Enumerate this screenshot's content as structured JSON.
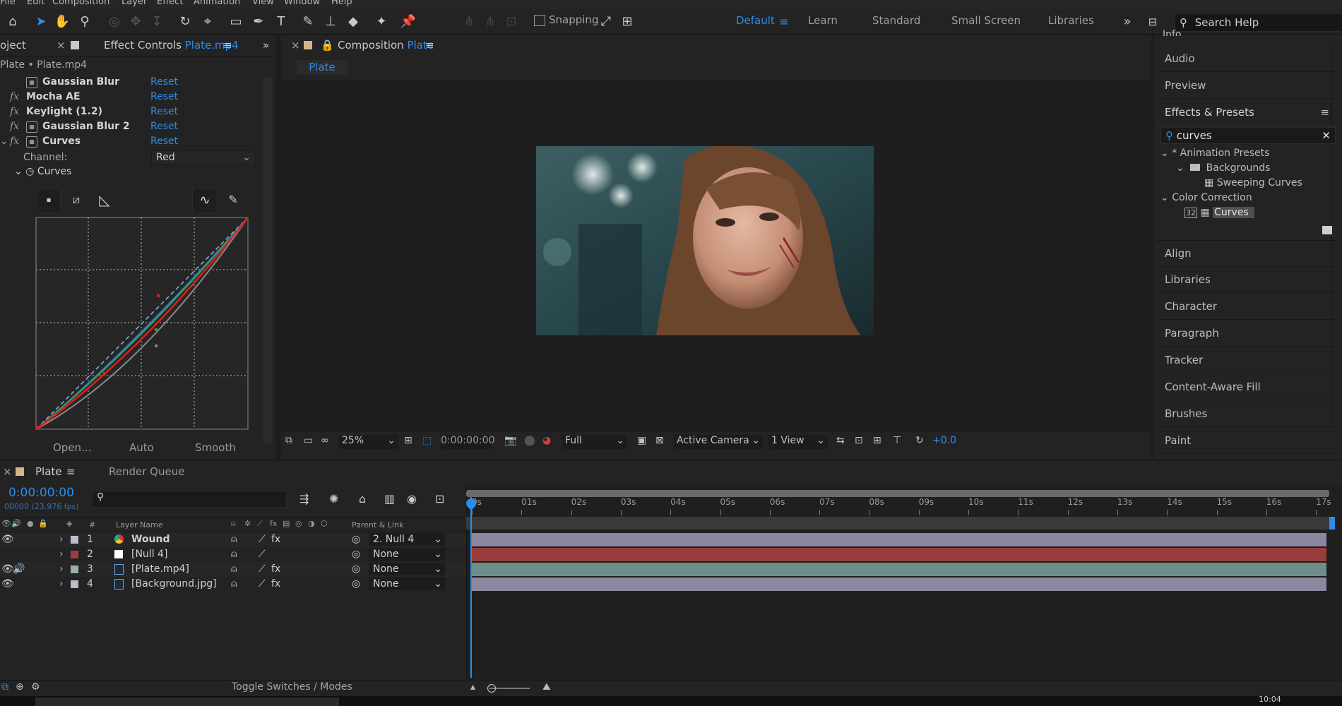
{
  "menu": [
    "File",
    "Edit",
    "Composition",
    "Layer",
    "Effect",
    "Animation",
    "View",
    "Window",
    "Help"
  ],
  "toolbar": {
    "snapping_label": "Snapping",
    "workspaces": [
      "Default",
      "Learn",
      "Standard",
      "Small Screen",
      "Libraries"
    ],
    "search_help_label": "Search Help"
  },
  "effect_controls": {
    "project_tab": "oject",
    "tab_label": "Effect Controls",
    "tab_target": "Plate.mp4",
    "breadcrumb": "Plate • Plate.mp4",
    "effects": [
      {
        "name": "Gaussian Blur",
        "reset": "Reset"
      },
      {
        "name": "Mocha AE",
        "reset": "Reset"
      },
      {
        "name": "Keylight (1.2)",
        "reset": "Reset"
      },
      {
        "name": "Gaussian Blur 2",
        "reset": "Reset"
      },
      {
        "name": "Curves",
        "reset": "Reset"
      }
    ],
    "fx_label": "fx",
    "channel_label": "Channel:",
    "channel_value": "Red",
    "curves_sublabel": "Curves",
    "bottom_buttons": [
      "Open...",
      "Auto",
      "Smooth"
    ]
  },
  "composition": {
    "tab_label": "Composition",
    "tab_target": "Plate",
    "subtab": "Plate",
    "zoom": "25%",
    "timecode": "0:00:00:00",
    "resolution": "Full",
    "camera": "Active Camera",
    "views": "1 View",
    "exposure": "+0.0"
  },
  "right_panel": {
    "info_cut": "Info",
    "items_top": [
      "Audio",
      "Preview"
    ],
    "effects_presets_title": "Effects & Presets",
    "search_value": "curves",
    "tree": {
      "animation_presets": "* Animation Presets",
      "backgrounds": "Backgrounds",
      "sweeping_curves": "Sweeping Curves",
      "color_correction": "Color Correction",
      "curves": "Curves",
      "bit_badge": "32"
    },
    "items_bottom": [
      "Align",
      "Libraries",
      "Character",
      "Paragraph",
      "Tracker",
      "Content-Aware Fill",
      "Brushes",
      "Paint"
    ]
  },
  "timeline": {
    "tab_label": "Plate",
    "render_queue_label": "Render Queue",
    "timecode": "0:00:00:00",
    "frames": "00000 (23.976 fps)",
    "col_hash": "#",
    "col_layer_name": "Layer Name",
    "col_parent": "Parent & Link",
    "ruler": [
      "0s",
      "01s",
      "02s",
      "03s",
      "04s",
      "05s",
      "06s",
      "07s",
      "08s",
      "09s",
      "10s",
      "11s",
      "12s",
      "13s",
      "14s",
      "15s",
      "16s",
      "17s"
    ],
    "layers": [
      {
        "num": "1",
        "name": "Wound",
        "parent": "2. Null 4",
        "label_color": "#b7bfc9",
        "bar_color": "#8a879e"
      },
      {
        "num": "2",
        "name": "[Null 4]",
        "parent": "None",
        "label_color": "#a23d3d",
        "bar_color": "#9b3c3c"
      },
      {
        "num": "3",
        "name": "[Plate.mp4]",
        "parent": "None",
        "label_color": "#9ab0b0",
        "bar_color": "#6e8e8b"
      },
      {
        "num": "4",
        "name": "[Background.jpg]",
        "parent": "None",
        "label_color": "#b7bfc9",
        "bar_color": "#8a879e"
      }
    ],
    "toggle_label": "Toggle Switches / Modes"
  },
  "taskbar": {
    "time": "10:04"
  },
  "colors": {
    "accent": "#2d8ceb",
    "playhead": "#2d8ceb",
    "curve_red": "#e01d1d",
    "curve_green": "#2f9a4a",
    "curve_blue": "#3c7dde"
  }
}
